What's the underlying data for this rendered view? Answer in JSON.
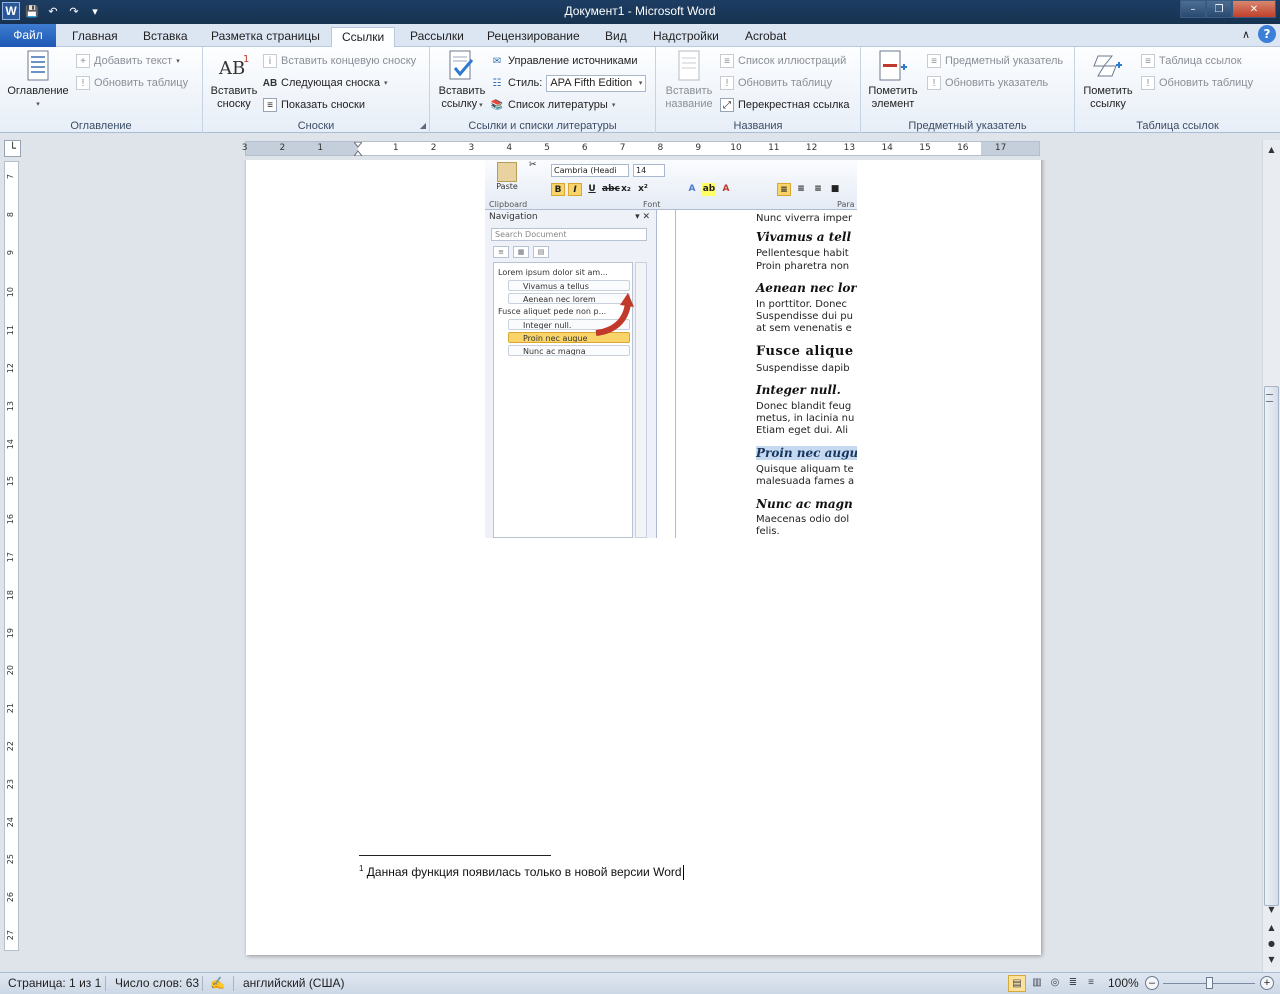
{
  "titlebar": {
    "title": "Документ1  -  Microsoft Word",
    "app_icon": "W",
    "qat": [
      "save-icon",
      "undo-icon",
      "redo-icon",
      "customize-icon"
    ]
  },
  "tabs": [
    "Файл",
    "Главная",
    "Вставка",
    "Разметка страницы",
    "Ссылки",
    "Рассылки",
    "Рецензирование",
    "Вид",
    "Надстройки",
    "Acrobat"
  ],
  "active_tab": "Ссылки",
  "ribbon": {
    "toc": {
      "label": "Оглавление",
      "add_text": "Добавить текст",
      "update_table": "Обновить таблицу",
      "group": "Оглавление"
    },
    "footnotes": {
      "insert_line1": "Вставить",
      "insert_line2": "сноску",
      "insert_endnote": "Вставить концевую сноску",
      "next_footnote": "Следующая сноска",
      "show_notes": "Показать сноски",
      "group": "Сноски"
    },
    "citations": {
      "insert_line1": "Вставить",
      "insert_line2": "ссылку",
      "manage_sources": "Управление источниками",
      "style_label": "Стиль:",
      "style_value": "APA Fifth Edition",
      "bibliography": "Список литературы",
      "group": "Ссылки и списки литературы"
    },
    "captions": {
      "insert_line1": "Вставить",
      "insert_line2": "название",
      "list_illustrations": "Список иллюстраций",
      "update_table": "Обновить таблицу",
      "cross_reference": "Перекрестная ссылка",
      "group": "Названия"
    },
    "index": {
      "mark_line1": "Пометить",
      "mark_line2": "элемент",
      "insert_index": "Предметный указатель",
      "update_index": "Обновить указатель",
      "group": "Предметный указатель"
    },
    "authorities": {
      "mark_line1": "Пометить",
      "mark_line2": "ссылку",
      "insert_table": "Таблица ссылок",
      "update_table": "Обновить таблицу",
      "group": "Таблица ссылок"
    }
  },
  "ruler": {
    "h_numbers": [
      "3",
      "2",
      "1",
      "1",
      "2",
      "3",
      "4",
      "5",
      "6",
      "7",
      "8",
      "9",
      "10",
      "11",
      "12",
      "13",
      "14",
      "15",
      "16",
      "17"
    ],
    "v_numbers": [
      "7",
      "8",
      "9",
      "10",
      "11",
      "12",
      "13",
      "14",
      "15",
      "16",
      "17",
      "18",
      "19",
      "20",
      "21",
      "22",
      "23",
      "24",
      "25",
      "26",
      "27"
    ]
  },
  "screenshot": {
    "paste": "Paste",
    "font_name": "Cambria (Headi",
    "font_size": "14",
    "clipboard": "Clipboard",
    "font_group": "Font",
    "para_group": "Para",
    "nav_title": "Navigation",
    "search_placeholder": "Search Document",
    "nav_items": [
      "Lorem ipsum dolor sit am...",
      "Vivamus a tellus",
      "Aenean nec lorem",
      "Fusce aliquet pede non p...",
      "Integer null.",
      "Proin nec augue",
      "Nunc ac magna"
    ],
    "doc": {
      "l0": "Nunc viverra imper",
      "h1": "Vivamus a tell",
      "l1a": "Pellentesque habit",
      "l1b": "Proin pharetra non",
      "h2": "Aenean nec lor",
      "l2a": "In porttitor.  Donec",
      "l2b": "Suspendisse dui pu",
      "l2c": "at sem venenatis e",
      "h3": "Fusce alique",
      "l3a": "Suspendisse dapib",
      "h4": "Integer null.",
      "l4a": "Donec blandit feug",
      "l4b": "metus, in lacinia nu",
      "l4c": "Etiam eget dui. Ali",
      "h5": "Proin nec augu",
      "l5a": "Quisque aliquam te",
      "l5b": "malesuada fames a",
      "h6": "Nunc ac magn",
      "l6a": "Maecenas odio dol",
      "l6b": "felis."
    }
  },
  "footnote": {
    "number": "1",
    "text": "Данная функция появилась только в новой версии Word"
  },
  "statusbar": {
    "page": "Страница: 1 из 1",
    "words": "Число слов: 63",
    "language": "английский (США)",
    "zoom": "100%"
  }
}
